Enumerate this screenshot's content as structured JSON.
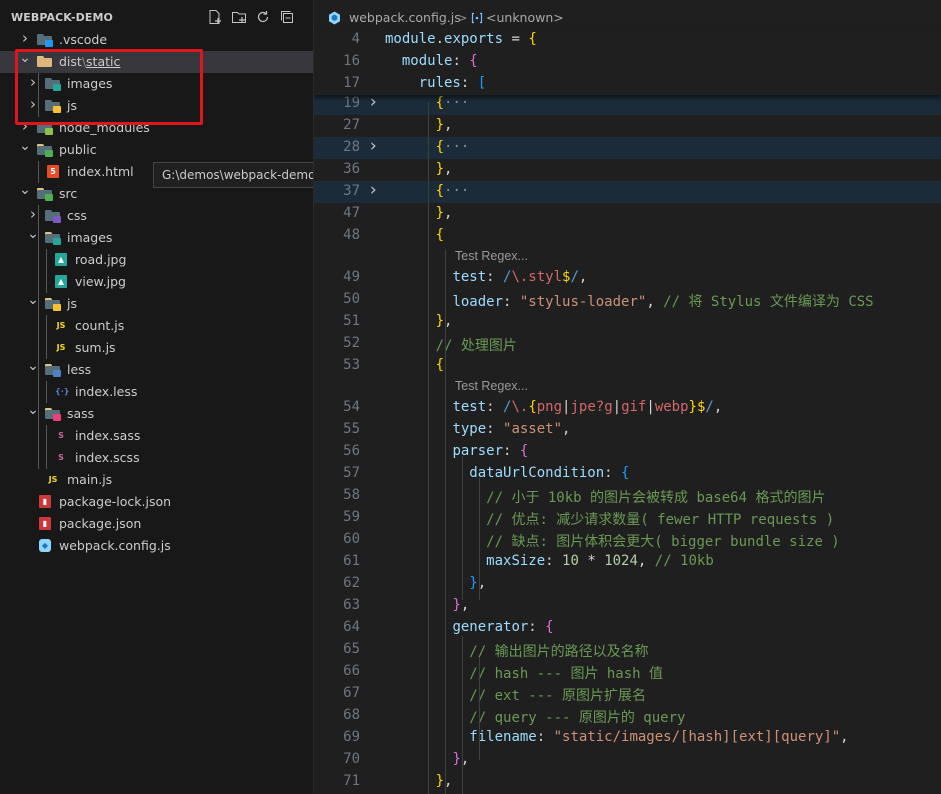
{
  "explorer": {
    "title": "WEBPACK-DEMO",
    "actions": [
      "new-file-icon",
      "new-folder-icon",
      "refresh-icon",
      "collapse-all-icon"
    ],
    "items": [
      {
        "label": "",
        "folder": ".vscode",
        "type": "folder",
        "icon": "vscode-folder-icon",
        "expanded": false,
        "depth": 0
      },
      {
        "label": "dist",
        "sep": "\\",
        "label2": "static",
        "type": "folder",
        "icon": "folder-open-icon",
        "expanded": true,
        "depth": 0
      },
      {
        "label": "images",
        "type": "folder",
        "icon": "images-folder-icon",
        "expanded": false,
        "depth": 1
      },
      {
        "label": "js",
        "type": "folder",
        "icon": "js-folder-icon",
        "expanded": false,
        "depth": 1
      },
      {
        "label": "node_modules",
        "type": "folder",
        "icon": "node-folder-icon",
        "expanded": false,
        "depth": 0
      },
      {
        "label": "public",
        "type": "folder",
        "icon": "public-folder-icon",
        "expanded": true,
        "depth": 0
      },
      {
        "label": "index.html",
        "type": "file",
        "icon": "html-file-icon",
        "depth": 1
      },
      {
        "label": "src",
        "type": "folder",
        "icon": "src-folder-icon",
        "expanded": true,
        "depth": 0
      },
      {
        "label": "css",
        "type": "folder",
        "icon": "css-folder-icon",
        "expanded": false,
        "depth": 1
      },
      {
        "label": "images",
        "type": "folder",
        "icon": "images-folder-icon",
        "expanded": true,
        "depth": 1
      },
      {
        "label": "road.jpg",
        "type": "file",
        "icon": "image-file-icon",
        "depth": 2
      },
      {
        "label": "view.jpg",
        "type": "file",
        "icon": "image-file-icon",
        "depth": 2
      },
      {
        "label": "js",
        "type": "folder",
        "icon": "js-folder-icon",
        "expanded": true,
        "depth": 1
      },
      {
        "label": "count.js",
        "type": "file",
        "icon": "js-file-icon",
        "depth": 2
      },
      {
        "label": "sum.js",
        "type": "file",
        "icon": "js-file-icon",
        "depth": 2
      },
      {
        "label": "less",
        "type": "folder",
        "icon": "less-folder-icon",
        "expanded": true,
        "depth": 1
      },
      {
        "label": "index.less",
        "type": "file",
        "icon": "less-file-icon",
        "depth": 2
      },
      {
        "label": "sass",
        "type": "folder",
        "icon": "sass-folder-icon",
        "expanded": true,
        "depth": 1
      },
      {
        "label": "index.sass",
        "type": "file",
        "icon": "sass-file-icon",
        "depth": 2
      },
      {
        "label": "index.scss",
        "type": "file",
        "icon": "sass-file-icon",
        "depth": 2
      },
      {
        "label": "main.js",
        "type": "file",
        "icon": "js-file-icon",
        "depth": 1
      },
      {
        "label": "package-lock.json",
        "type": "file",
        "icon": "npm-file-icon",
        "depth": 0
      },
      {
        "label": "package.json",
        "type": "file",
        "icon": "npm-file-icon",
        "depth": 0
      },
      {
        "label": "webpack.config.js",
        "type": "file",
        "icon": "webpack-file-icon",
        "depth": 0
      }
    ],
    "tooltip": "G:\\demos\\webpack-demo\\public"
  },
  "breadcrumb": {
    "file": "webpack.config.js",
    "separator": ">",
    "symbol": "<unknown>"
  },
  "sticky_lines": [
    {
      "n": "4",
      "tokens": [
        [
          "kw",
          "module"
        ],
        [
          "p",
          "."
        ],
        [
          "kw",
          "exports"
        ],
        [
          "p",
          " = "
        ],
        [
          "b1",
          "{"
        ]
      ]
    },
    {
      "n": "16",
      "tokens": [
        [
          "p",
          "  "
        ],
        [
          "kw",
          "module"
        ],
        [
          "p",
          ": "
        ],
        [
          "b2",
          "{"
        ]
      ]
    },
    {
      "n": "17",
      "tokens": [
        [
          "p",
          "    "
        ],
        [
          "kw",
          "rules"
        ],
        [
          "p",
          ": "
        ],
        [
          "b3",
          "["
        ]
      ]
    }
  ],
  "code_lines": [
    {
      "n": "19",
      "fold": true,
      "hl": true,
      "tokens": [
        [
          "p",
          "      "
        ],
        [
          "b1",
          "{"
        ],
        [
          "ell",
          "···"
        ]
      ]
    },
    {
      "n": "27",
      "tokens": [
        [
          "p",
          "      "
        ],
        [
          "b1",
          "}"
        ],
        [
          "p",
          ","
        ]
      ]
    },
    {
      "n": "28",
      "fold": true,
      "hl": true,
      "tokens": [
        [
          "p",
          "      "
        ],
        [
          "b1",
          "{"
        ],
        [
          "ell",
          "···"
        ]
      ]
    },
    {
      "n": "36",
      "tokens": [
        [
          "p",
          "      "
        ],
        [
          "b1",
          "}"
        ],
        [
          "p",
          ","
        ]
      ]
    },
    {
      "n": "37",
      "fold": true,
      "hl": true,
      "tokens": [
        [
          "p",
          "      "
        ],
        [
          "b1",
          "{"
        ],
        [
          "ell",
          "···"
        ]
      ]
    },
    {
      "n": "47",
      "tokens": [
        [
          "p",
          "      "
        ],
        [
          "b1",
          "}"
        ],
        [
          "p",
          ","
        ]
      ]
    },
    {
      "n": "48",
      "tokens": [
        [
          "p",
          "      "
        ],
        [
          "b1",
          "{"
        ]
      ]
    },
    {
      "lens": "Test Regex..."
    },
    {
      "n": "49",
      "tokens": [
        [
          "p",
          "        "
        ],
        [
          "kw",
          "test"
        ],
        [
          "p",
          ": "
        ],
        [
          "rq",
          "/"
        ],
        [
          "re",
          "\\.styl"
        ],
        [
          "b1",
          "$"
        ],
        [
          "rq",
          "/"
        ],
        [
          "p",
          ","
        ]
      ]
    },
    {
      "n": "50",
      "tokens": [
        [
          "p",
          "        "
        ],
        [
          "kw",
          "loader"
        ],
        [
          "p",
          ": "
        ],
        [
          "s",
          "\"stylus-loader\""
        ],
        [
          "p",
          ", "
        ],
        [
          "c",
          "// 将 Stylus 文件编译为 CSS"
        ]
      ]
    },
    {
      "n": "51",
      "tokens": [
        [
          "p",
          "      "
        ],
        [
          "b1",
          "}"
        ],
        [
          "p",
          ","
        ]
      ]
    },
    {
      "n": "52",
      "tokens": [
        [
          "p",
          "      "
        ],
        [
          "c",
          "// 处理图片"
        ]
      ]
    },
    {
      "n": "53",
      "tokens": [
        [
          "p",
          "      "
        ],
        [
          "b1",
          "{"
        ]
      ]
    },
    {
      "lens": "Test Regex..."
    },
    {
      "n": "54",
      "tokens": [
        [
          "p",
          "        "
        ],
        [
          "kw",
          "test"
        ],
        [
          "p",
          ": "
        ],
        [
          "rq",
          "/"
        ],
        [
          "re",
          "\\."
        ],
        [
          "b1",
          "{"
        ],
        [
          "re",
          "png"
        ],
        [
          "p",
          "|"
        ],
        [
          "re",
          "jpe?g"
        ],
        [
          "p",
          "|"
        ],
        [
          "re",
          "gif"
        ],
        [
          "p",
          "|"
        ],
        [
          "re",
          "webp"
        ],
        [
          "b1",
          "}"
        ],
        [
          "b1",
          "$"
        ],
        [
          "rq",
          "/"
        ],
        [
          "p",
          ","
        ]
      ]
    },
    {
      "n": "55",
      "tokens": [
        [
          "p",
          "        "
        ],
        [
          "kw",
          "type"
        ],
        [
          "p",
          ": "
        ],
        [
          "s",
          "\"asset\""
        ],
        [
          "p",
          ","
        ]
      ]
    },
    {
      "n": "56",
      "tokens": [
        [
          "p",
          "        "
        ],
        [
          "kw",
          "parser"
        ],
        [
          "p",
          ": "
        ],
        [
          "b2",
          "{"
        ]
      ]
    },
    {
      "n": "57",
      "tokens": [
        [
          "p",
          "          "
        ],
        [
          "kw",
          "dataUrlCondition"
        ],
        [
          "p",
          ": "
        ],
        [
          "b3",
          "{"
        ]
      ]
    },
    {
      "n": "58",
      "tokens": [
        [
          "p",
          "            "
        ],
        [
          "c",
          "// 小于 10kb 的图片会被转成 base64 格式的图片"
        ]
      ]
    },
    {
      "n": "59",
      "tokens": [
        [
          "p",
          "            "
        ],
        [
          "c",
          "// 优点: 减少请求数量( fewer HTTP requests )"
        ]
      ]
    },
    {
      "n": "60",
      "tokens": [
        [
          "p",
          "            "
        ],
        [
          "c",
          "// 缺点: 图片体积会更大( bigger bundle size )"
        ]
      ]
    },
    {
      "n": "61",
      "tokens": [
        [
          "p",
          "            "
        ],
        [
          "kw",
          "maxSize"
        ],
        [
          "p",
          ": "
        ],
        [
          "n",
          "10"
        ],
        [
          "p",
          " * "
        ],
        [
          "n",
          "1024"
        ],
        [
          "p",
          ", "
        ],
        [
          "c",
          "// 10kb"
        ]
      ]
    },
    {
      "n": "62",
      "tokens": [
        [
          "p",
          "          "
        ],
        [
          "b3",
          "}"
        ],
        [
          "p",
          ","
        ]
      ]
    },
    {
      "n": "63",
      "tokens": [
        [
          "p",
          "        "
        ],
        [
          "b2",
          "}"
        ],
        [
          "p",
          ","
        ]
      ]
    },
    {
      "n": "64",
      "tokens": [
        [
          "p",
          "        "
        ],
        [
          "kw",
          "generator"
        ],
        [
          "p",
          ": "
        ],
        [
          "b2",
          "{"
        ]
      ]
    },
    {
      "n": "65",
      "tokens": [
        [
          "p",
          "          "
        ],
        [
          "c",
          "// 输出图片的路径以及名称"
        ]
      ]
    },
    {
      "n": "66",
      "tokens": [
        [
          "p",
          "          "
        ],
        [
          "c",
          "// hash --- 图片 hash 值"
        ]
      ]
    },
    {
      "n": "67",
      "tokens": [
        [
          "p",
          "          "
        ],
        [
          "c",
          "// ext --- 原图片扩展名"
        ]
      ]
    },
    {
      "n": "68",
      "tokens": [
        [
          "p",
          "          "
        ],
        [
          "c",
          "// query --- 原图片的 query"
        ]
      ]
    },
    {
      "n": "69",
      "tokens": [
        [
          "p",
          "          "
        ],
        [
          "kw",
          "filename"
        ],
        [
          "p",
          ": "
        ],
        [
          "s",
          "\"static/images/[hash][ext][query]\""
        ],
        [
          "p",
          ","
        ]
      ]
    },
    {
      "n": "70",
      "tokens": [
        [
          "p",
          "        "
        ],
        [
          "b2",
          "}"
        ],
        [
          "p",
          ","
        ]
      ]
    },
    {
      "n": "71",
      "tokens": [
        [
          "p",
          "      "
        ],
        [
          "b1",
          "}"
        ],
        [
          "p",
          ","
        ]
      ]
    }
  ],
  "colors": {
    "sidebar_bg": "#181818",
    "editor_bg": "#1f1f1f",
    "selection": "#37373d",
    "annotation_red": "#e0161d"
  }
}
